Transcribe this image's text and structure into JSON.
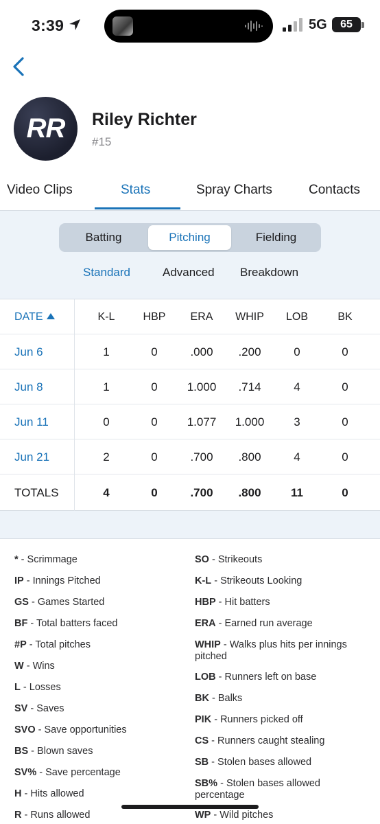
{
  "status_bar": {
    "time": "3:39",
    "network": "5G",
    "battery": "65",
    "icons": [
      "location-arrow-icon",
      "signal-bars-icon",
      "audio-wave-icon"
    ]
  },
  "player": {
    "initials": "RR",
    "name": "Riley Richter",
    "number": "#15"
  },
  "tabs": [
    {
      "label": "Video Clips",
      "active": false
    },
    {
      "label": "Stats",
      "active": true
    },
    {
      "label": "Spray Charts",
      "active": false
    },
    {
      "label": "Contacts",
      "active": false
    }
  ],
  "stat_types": [
    {
      "label": "Batting",
      "active": false
    },
    {
      "label": "Pitching",
      "active": true
    },
    {
      "label": "Fielding",
      "active": false
    }
  ],
  "stat_views": [
    {
      "label": "Standard",
      "active": true
    },
    {
      "label": "Advanced",
      "active": false
    },
    {
      "label": "Breakdown",
      "active": false
    }
  ],
  "table": {
    "columns": [
      "DATE",
      "K-L",
      "HBP",
      "ERA",
      "WHIP",
      "LOB",
      "BK"
    ],
    "rows": [
      {
        "date": "Jun 6",
        "kl": "1",
        "hbp": "0",
        "era": ".000",
        "whip": ".200",
        "lob": "0",
        "bk": "0"
      },
      {
        "date": "Jun 8",
        "kl": "1",
        "hbp": "0",
        "era": "1.000",
        "whip": ".714",
        "lob": "4",
        "bk": "0"
      },
      {
        "date": "Jun 11",
        "kl": "0",
        "hbp": "0",
        "era": "1.077",
        "whip": "1.000",
        "lob": "3",
        "bk": "0"
      },
      {
        "date": "Jun 21",
        "kl": "2",
        "hbp": "0",
        "era": ".700",
        "whip": ".800",
        "lob": "4",
        "bk": "0"
      }
    ],
    "totals": {
      "label": "TOTALS",
      "kl": "4",
      "hbp": "0",
      "era": ".700",
      "whip": ".800",
      "lob": "11",
      "bk": "0"
    }
  },
  "legend": {
    "left": [
      {
        "abbr": "*",
        "desc": "Scrimmage"
      },
      {
        "abbr": "IP",
        "desc": "Innings Pitched"
      },
      {
        "abbr": "GS",
        "desc": "Games Started"
      },
      {
        "abbr": "BF",
        "desc": "Total batters faced"
      },
      {
        "abbr": "#P",
        "desc": "Total pitches"
      },
      {
        "abbr": "W",
        "desc": "Wins"
      },
      {
        "abbr": "L",
        "desc": "Losses"
      },
      {
        "abbr": "SV",
        "desc": "Saves"
      },
      {
        "abbr": "SVO",
        "desc": "Save opportunities"
      },
      {
        "abbr": "BS",
        "desc": "Blown saves"
      },
      {
        "abbr": "SV%",
        "desc": "Save percentage"
      },
      {
        "abbr": "H",
        "desc": "Hits allowed"
      },
      {
        "abbr": "R",
        "desc": "Runs allowed"
      }
    ],
    "right": [
      {
        "abbr": "SO",
        "desc": "Strikeouts"
      },
      {
        "abbr": "K-L",
        "desc": "Strikeouts Looking"
      },
      {
        "abbr": "HBP",
        "desc": "Hit batters"
      },
      {
        "abbr": "ERA",
        "desc": "Earned run average"
      },
      {
        "abbr": "WHIP",
        "desc": "Walks plus hits per innings pitched"
      },
      {
        "abbr": "LOB",
        "desc": "Runners left on base"
      },
      {
        "abbr": "BK",
        "desc": "Balks"
      },
      {
        "abbr": "PIK",
        "desc": "Runners picked off"
      },
      {
        "abbr": "CS",
        "desc": "Runners caught stealing"
      },
      {
        "abbr": "SB",
        "desc": "Stolen bases allowed"
      },
      {
        "abbr": "SB%",
        "desc": "Stolen bases allowed percentage"
      },
      {
        "abbr": "WP",
        "desc": "Wild pitches"
      }
    ]
  },
  "colors": {
    "accent": "#1a73b8",
    "panel_background": "#edf3f9",
    "text": "#1c1c1e"
  }
}
